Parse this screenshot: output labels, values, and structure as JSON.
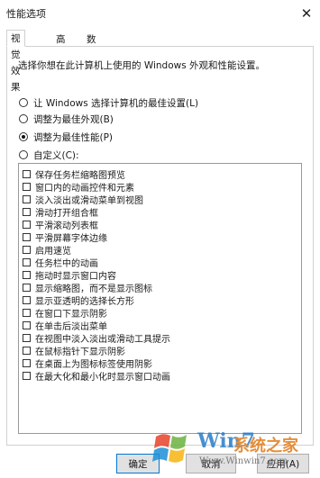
{
  "window": {
    "title": "性能选项",
    "close_glyph": "✕"
  },
  "tabs": [
    {
      "label": "视觉效果",
      "active": true
    },
    {
      "label": "高级",
      "active": false
    },
    {
      "label": "数据执行保护",
      "active": false
    }
  ],
  "visual_effects": {
    "description": "选择你想在此计算机上使用的 Windows 外观和性能设置。",
    "radios": [
      {
        "label": "让 Windows 选择计算机的最佳设置(L)",
        "checked": false
      },
      {
        "label": "调整为最佳外观(B)",
        "checked": false
      },
      {
        "label": "调整为最佳性能(P)",
        "checked": true
      },
      {
        "label": "自定义(C):",
        "checked": false
      }
    ],
    "checkboxes": [
      {
        "label": "保存任务栏缩略图预览",
        "checked": false
      },
      {
        "label": "窗口内的动画控件和元素",
        "checked": false
      },
      {
        "label": "淡入淡出或滑动菜单到视图",
        "checked": false
      },
      {
        "label": "滑动打开组合框",
        "checked": false
      },
      {
        "label": "平滑滚动列表框",
        "checked": false
      },
      {
        "label": "平滑屏幕字体边缘",
        "checked": false
      },
      {
        "label": "启用速览",
        "checked": false
      },
      {
        "label": "任务栏中的动画",
        "checked": false
      },
      {
        "label": "拖动时显示窗口内容",
        "checked": false
      },
      {
        "label": "显示缩略图，而不是显示图标",
        "checked": false
      },
      {
        "label": "显示亚透明的选择长方形",
        "checked": false
      },
      {
        "label": "在窗口下显示阴影",
        "checked": false
      },
      {
        "label": "在单击后淡出菜单",
        "checked": false
      },
      {
        "label": "在视图中淡入淡出或滑动工具提示",
        "checked": false
      },
      {
        "label": "在鼠标指针下显示阴影",
        "checked": false
      },
      {
        "label": "在桌面上为图标标签使用阴影",
        "checked": false
      },
      {
        "label": "在最大化和最小化时显示窗口动画",
        "checked": false
      }
    ]
  },
  "buttons": {
    "ok": "确定",
    "cancel": "取消",
    "apply": "应用(A)"
  },
  "watermark": {
    "brand": "Win7",
    "brand_cn": "系统之家",
    "url": "Www.Winwin7.com"
  }
}
